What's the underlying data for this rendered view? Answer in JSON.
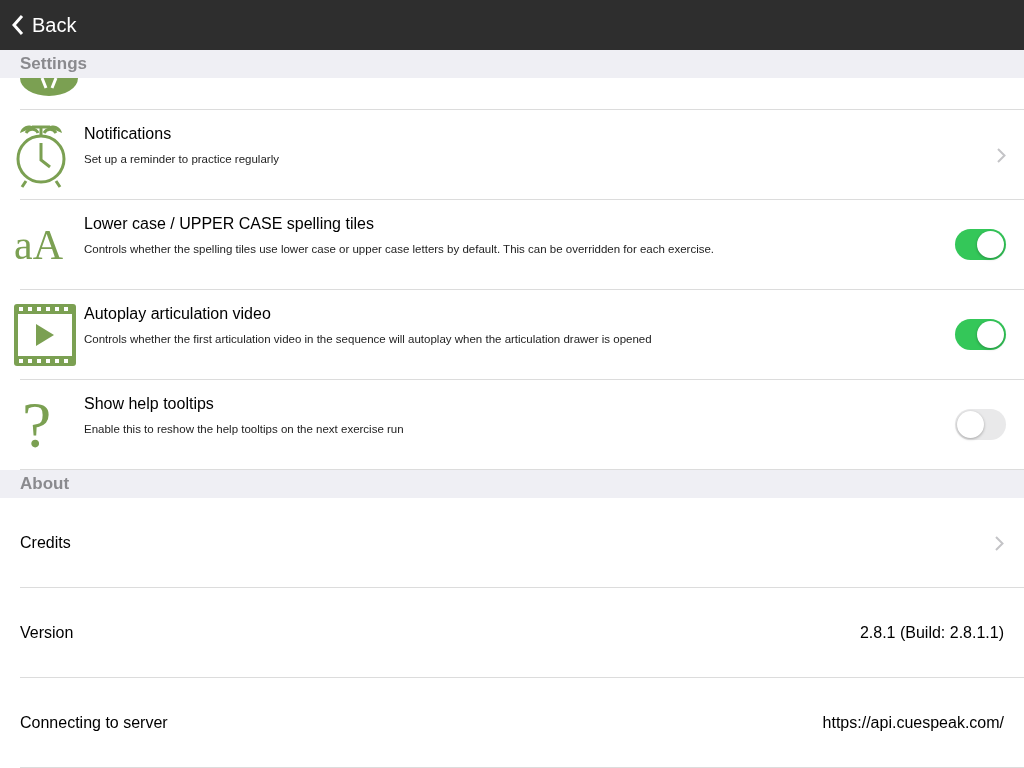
{
  "nav": {
    "back_label": "Back"
  },
  "sections": [
    {
      "title": "Settings",
      "items": [
        {
          "kind": "partial"
        },
        {
          "kind": "link",
          "title": "Notifications",
          "subtitle": "Set up a reminder to practice regularly"
        },
        {
          "kind": "toggle",
          "icon_text": "aA",
          "title": "Lower case / UPPER CASE spelling tiles",
          "subtitle": "Controls whether the spelling tiles use lower case or upper case letters by default. This can be overridden for each exercise.",
          "on": true
        },
        {
          "kind": "toggle",
          "title": "Autoplay articulation video",
          "subtitle": "Controls whether the first articulation video in the sequence will autoplay when the articulation drawer is opened",
          "on": true
        },
        {
          "kind": "toggle",
          "icon_text": "?",
          "title": "Show help tooltips",
          "subtitle": "Enable this to reshow the help tooltips on the next exercise run",
          "on": false
        }
      ]
    },
    {
      "title": "About",
      "items": [
        {
          "kind": "link",
          "title": "Credits"
        },
        {
          "kind": "value",
          "title": "Version",
          "value": "2.8.1 (Build: 2.8.1.1)"
        },
        {
          "kind": "value",
          "title": "Connecting to server",
          "value": "https://api.cuespeak.com/"
        }
      ]
    }
  ]
}
